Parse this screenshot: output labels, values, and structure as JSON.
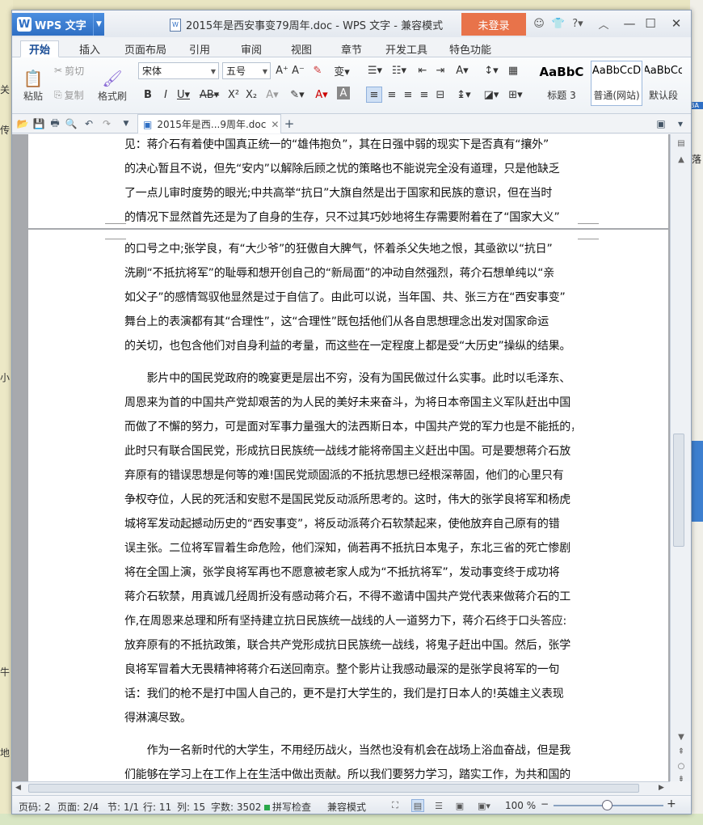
{
  "background": {
    "left_marks": [
      "关",
      "传",
      "小",
      "牛",
      "地"
    ],
    "right_marks": [
      "落",
      "BA"
    ]
  },
  "titlebar": {
    "app_name": "WPS 文字",
    "document_title": "2015年是西安事变79周年.doc - WPS 文字 - 兼容模式",
    "login_label": "未登录"
  },
  "tabs": [
    "开始",
    "插入",
    "页面布局",
    "引用",
    "审阅",
    "视图",
    "章节",
    "开发工具",
    "特色功能"
  ],
  "ribbon": {
    "paste": "粘贴",
    "cut": "剪切",
    "copy": "复制",
    "format_painter": "格式刷",
    "font_name": "宋体",
    "font_size": "五号",
    "styles": [
      {
        "sample": "AaBbC",
        "label": "标题 3"
      },
      {
        "sample": "AaBbCcD",
        "label": "普通(网站)"
      },
      {
        "sample": "AaBbCc",
        "label": "默认段"
      }
    ]
  },
  "quickbar": {
    "doc_tab_label": "2015年是西...9周年.doc"
  },
  "document": {
    "page1_lines": [
      "见：蒋介石有着使中国真正统一的“雄伟抱负”，其在日强中弱的现实下是否真有“攘外”",
      "的决心暂且不说，但先“安内”以解除后顾之忧的策略也不能说完全没有道理，只是他缺乏",
      "了一点儿审时度势的眼光;中共高举“抗日”大旗自然是出于国家和民族的意识，但在当时",
      "的情况下显然首先还是为了自身的生存，只不过其巧妙地将生存需要附着在了“国家大义”"
    ],
    "page2_para1": [
      "的口号之中;张学良，有“大少爷”的狂傲自大脾气，怀着杀父失地之恨，其亟欲以“抗日”",
      "洗刷“不抵抗将军”的耻辱和想开创自己的“新局面”的冲动自然强烈，蒋介石想单纯以“亲",
      "如父子”的感情驾驭他显然是过于自信了。由此可以说，当年国、共、张三方在“西安事变”",
      "舞台上的表演都有其“合理性”，这“合理性”既包括他们从各自思想理念出发对国家命运",
      "的关切，也包含他们对自身利益的考量，而这些在一定程度上都是受“大历史”操纵的结果。"
    ],
    "page2_para2": [
      "　　影片中的国民党政府的晚宴更是层出不穷，没有为国民做过什么实事。此时以毛泽东、",
      "周恩来为首的中国共产党却艰苦的为人民的美好未来奋斗，为将日本帝国主义军队赶出中国",
      "而做了不懈的努力，可是面对军事力量强大的法西斯日本，中国共产党的军力也是不能抵的，",
      "此时只有联合国民党，形成抗日民族统一战线才能将帝国主义赶出中国。可是要想蒋介石放",
      "弃原有的错误思想是何等的难!国民党顽固派的不抵抗思想已经根深蒂固，他们的心里只有",
      "争权夺位，人民的死活和安慰不是国民党反动派所思考的。这时，伟大的张学良将军和杨虎",
      "城将军发动起撼动历史的“西安事变”，将反动派蒋介石软禁起来，使他放弃自己原有的错",
      "误主张。二位将军冒着生命危险，他们深知，倘若再不抵抗日本鬼子，东北三省的死亡惨剧",
      "将在全国上演，张学良将军再也不愿意被老家人成为“不抵抗将军”，发动事变终于成功将",
      "蒋介石软禁，用真诚几经周折没有感动蒋介石，不得不邀请中国共产党代表来做蒋介石的工",
      "作,在周恩来总理和所有坚持建立抗日民族统一战线的人一道努力下，蒋介石终于口头答应:",
      "放弃原有的不抵抗政策，联合共产党形成抗日民族统一战线，将鬼子赶出中国。然后，张学",
      "良将军冒着大无畏精神将蒋介石送回南京。整个影片让我感动最深的是张学良将军的一句",
      "话：我们的枪不是打中国人自己的，更不是打大学生的，我们是打日本人的!英雄主义表现",
      "得淋漓尽致。"
    ],
    "page2_para3": [
      "　　作为一名新时代的大学生，不用经历战火，当然也没有机会在战场上浴血奋战，但是我",
      "们能够在学习上在工作上在生活中做出贡献。所以我们要努力学习，踏实工作，为共和国的"
    ]
  },
  "statusbar": {
    "page_num": "页码: 2",
    "pages": "页面: 2/4",
    "section": "节: 1/1",
    "row": "行: 11",
    "col": "列: 15",
    "word_count": "字数: 3502",
    "spell_check": "拼写检查",
    "compat_mode": "兼容模式",
    "zoom": "100 %"
  }
}
